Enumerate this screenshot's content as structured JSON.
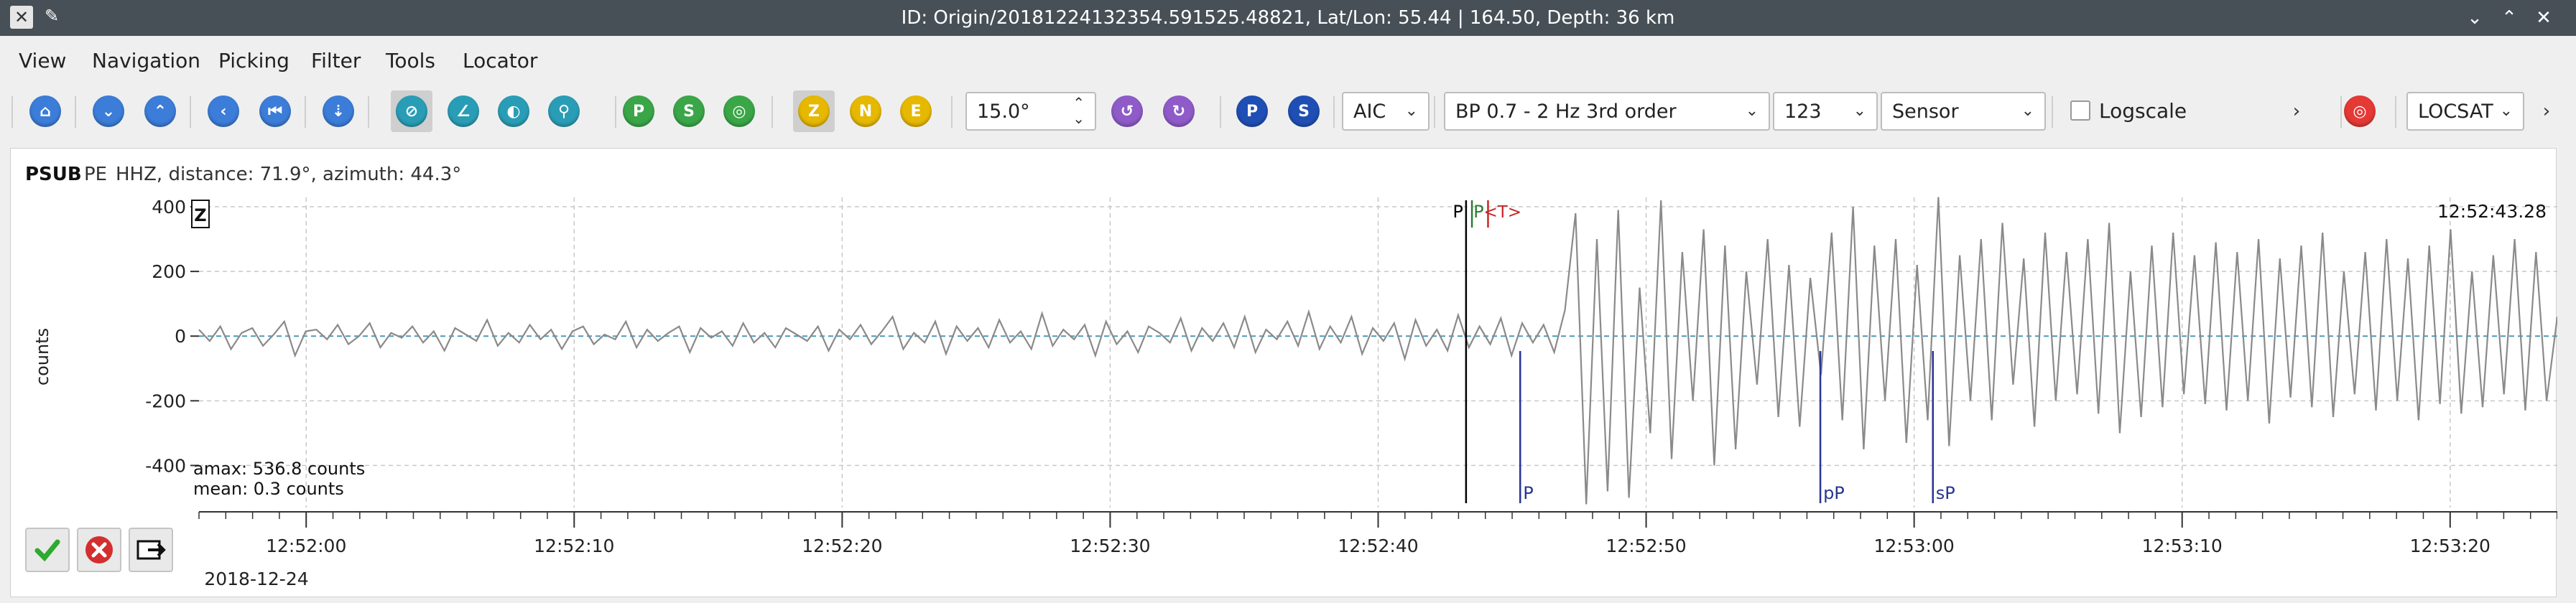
{
  "window": {
    "title": "ID: Origin/20181224132354.591525.48821, Lat/Lon: 55.44 | 164.50, Depth: 36 km"
  },
  "menu": [
    "View",
    "Navigation",
    "Picking",
    "Filter",
    "Tools",
    "Locator"
  ],
  "toolbar": {
    "component_buttons": [
      "Z",
      "N",
      "E"
    ],
    "phase_buttons": [
      "P",
      "S"
    ],
    "angle_value": "15.0°",
    "picker": "AIC",
    "filter": "BP 0.7 - 2 Hz  3rd order",
    "channel_value": "123",
    "unit": "Sensor",
    "logscale_label": "Logscale",
    "locator": "LOCSAT"
  },
  "trace": {
    "station": "PSUB",
    "network": "PE",
    "channel_info": "HHZ, distance: 71.9°, azimuth: 44.3°",
    "component_badge": "Z",
    "ylabel": "counts",
    "time_label": "12:52:43.28",
    "amax": "amax: 536.8 counts",
    "mean": "mean: 0.3 counts",
    "date": "2018-12-24"
  },
  "chart_data": {
    "type": "line",
    "ylabel": "counts",
    "ylim": [
      -530,
      420
    ],
    "yticks": [
      400,
      200,
      0,
      -200,
      -400
    ],
    "xticks": [
      "12:52:00",
      "12:52:10",
      "12:52:20",
      "12:52:30",
      "12:52:40",
      "12:52:50",
      "12:53:00",
      "12:53:10",
      "12:53:20"
    ],
    "x_start": "12:51:56",
    "x_end": "12:53:24",
    "grid": true,
    "picks": [
      {
        "label": "P",
        "time": "12:52:43.28",
        "color": "#000000"
      },
      {
        "label": "P",
        "time": "12:52:43.5",
        "color": "#2e7d32"
      },
      {
        "label": "<T>",
        "time": "12:52:44.1",
        "color": "#c62828"
      },
      {
        "label": "P",
        "time": "12:52:45.3",
        "color": "#283593"
      },
      {
        "label": "pP",
        "time": "12:52:56.5",
        "color": "#283593"
      },
      {
        "label": "sP",
        "time": "12:53:00.7",
        "color": "#283593"
      }
    ],
    "series": [
      {
        "values": [
          20,
          -15,
          30,
          -40,
          10,
          25,
          -30,
          5,
          45,
          -60,
          15,
          20,
          -10,
          35,
          -25,
          0,
          40,
          -35,
          10,
          -5,
          30,
          -20,
          15,
          -45,
          25,
          5,
          -15,
          50,
          -30,
          10,
          -20,
          35,
          -10,
          20,
          -40,
          15,
          30,
          -25,
          5,
          -10,
          45,
          -35,
          20,
          -15,
          10,
          30,
          -50,
          25,
          -5,
          15,
          -30,
          40,
          -20,
          10,
          -35,
          25,
          5,
          -15,
          30,
          -45,
          20,
          -10,
          35,
          -25,
          15,
          60,
          -40,
          10,
          -20,
          45,
          -55,
          30,
          -15,
          25,
          -35,
          50,
          -20,
          15,
          -40,
          70,
          -30,
          20,
          -10,
          35,
          -60,
          45,
          -25,
          15,
          -50,
          30,
          10,
          -20,
          55,
          -45,
          25,
          -15,
          40,
          -35,
          60,
          -50,
          20,
          -10,
          45,
          -30,
          75,
          -40,
          30,
          -20,
          60,
          -55,
          25,
          -15,
          40,
          -70,
          50,
          -30,
          20,
          -45,
          65,
          -35,
          30,
          -25,
          55,
          -60,
          40,
          -20,
          35,
          -50,
          80,
          380,
          -520,
          300,
          -480,
          390,
          -500,
          150,
          -300,
          420,
          -380,
          260,
          -200,
          330,
          -400,
          280,
          -350,
          200,
          -150,
          300,
          -250,
          220,
          -280,
          180,
          -120,
          320,
          -260,
          400,
          -350,
          280,
          -200,
          300,
          -330,
          220,
          -260,
          430,
          -340,
          250,
          -200,
          300,
          -260,
          350,
          -150,
          240,
          -280,
          320,
          -200,
          260,
          -180,
          300,
          -240,
          350,
          -300,
          200,
          -250,
          280,
          -220,
          320,
          -180,
          250,
          -210,
          290,
          -230,
          260,
          -200,
          300,
          -270,
          240,
          -190,
          280,
          -220,
          320,
          -250,
          200,
          -180,
          260,
          -230,
          300,
          -200,
          240,
          -260,
          280,
          -210,
          330,
          -240,
          200,
          -220,
          250,
          -180,
          300,
          -230,
          260,
          -200,
          60
        ]
      }
    ]
  },
  "icons": {
    "accept": "checkmark-icon",
    "reject": "reject-icon",
    "commit": "export-icon"
  }
}
